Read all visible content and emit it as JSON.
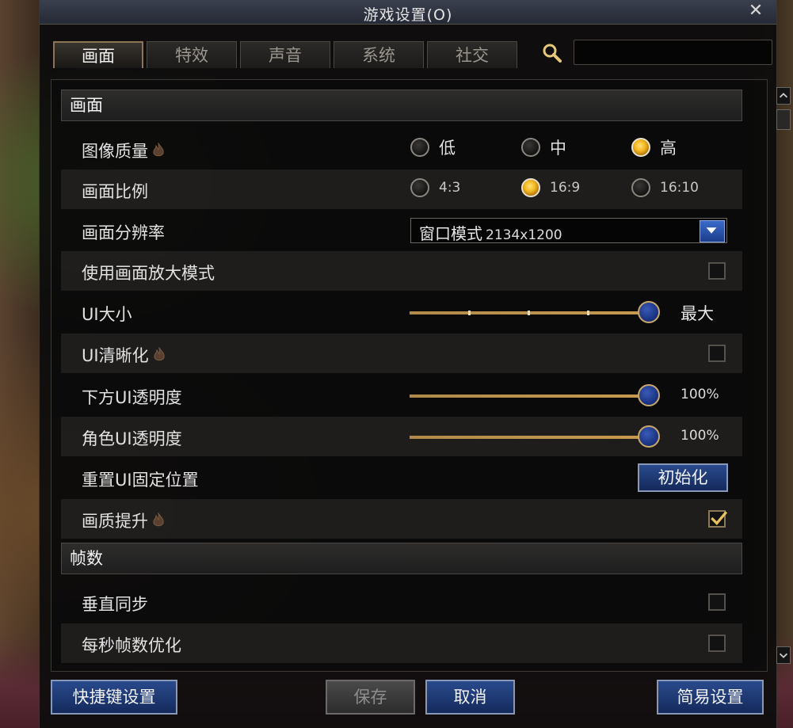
{
  "window": {
    "title": "游戏设置(O)",
    "close": "✕"
  },
  "tabs": [
    {
      "label": "画面",
      "active": true
    },
    {
      "label": "特效",
      "active": false
    },
    {
      "label": "声音",
      "active": false
    },
    {
      "label": "系统",
      "active": false
    },
    {
      "label": "社交",
      "active": false
    }
  ],
  "search": {
    "value": "",
    "placeholder": ""
  },
  "sections": {
    "display": "画面",
    "fps": "帧数"
  },
  "settings": {
    "image_quality": {
      "label": "图像质量",
      "hot": true,
      "options": [
        {
          "label": "低",
          "selected": false
        },
        {
          "label": "中",
          "selected": false
        },
        {
          "label": "高",
          "selected": true
        }
      ]
    },
    "aspect_ratio": {
      "label": "画面比例",
      "options": [
        {
          "label": "4:3",
          "selected": false
        },
        {
          "label": "16:9",
          "selected": true
        },
        {
          "label": "16:10",
          "selected": false
        }
      ]
    },
    "resolution": {
      "label": "画面分辨率",
      "mode": "窗口模式",
      "value": "2134x1200"
    },
    "zoom_mode": {
      "label": "使用画面放大模式",
      "checked": false
    },
    "ui_size": {
      "label": "UI大小",
      "value_label": "最大",
      "level": 1.0
    },
    "ui_sharpness": {
      "label": "UI清晰化",
      "hot": true,
      "checked": false
    },
    "bottom_ui_opacity": {
      "label": "下方UI透明度",
      "value": "100%",
      "level": 1.0
    },
    "char_ui_opacity": {
      "label": "角色UI透明度",
      "value": "100%",
      "level": 1.0
    },
    "reset_ui": {
      "label": "重置UI固定位置",
      "button": "初始化"
    },
    "quality_boost": {
      "label": "画质提升",
      "hot": true,
      "checked": true
    },
    "vsync": {
      "label": "垂直同步",
      "checked": false
    },
    "fps_opt": {
      "label": "每秒帧数优化",
      "checked": false
    }
  },
  "footer": {
    "hotkeys": "快捷键设置",
    "save": "保存",
    "cancel": "取消",
    "simple": "简易设置"
  },
  "colors": {
    "accent_gold": "#c89a50",
    "button_blue": "#1c3e8c",
    "check_gold": "#e8c060"
  }
}
